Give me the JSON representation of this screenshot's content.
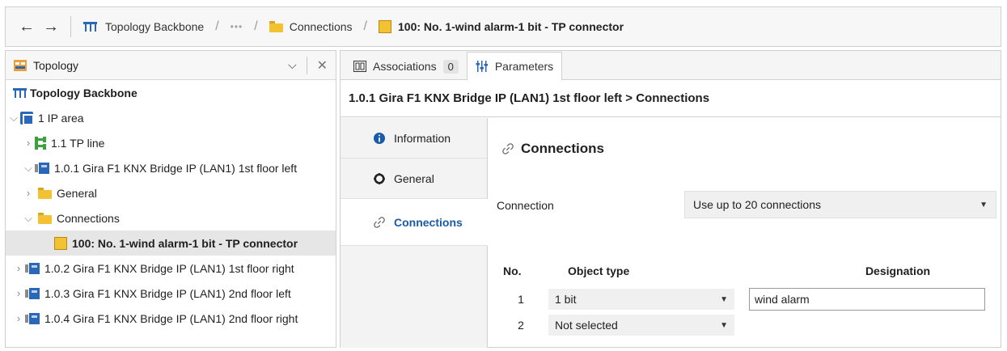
{
  "breadcrumb": {
    "back_label": "←",
    "forward_label": "→",
    "items": [
      {
        "label": "Topology Backbone"
      },
      {
        "label": "•••"
      },
      {
        "label": "Connections"
      },
      {
        "label": "100: No. 1-wind alarm-1 bit - TP connector"
      }
    ],
    "separator": "/"
  },
  "left_panel": {
    "title": "Topology",
    "chevron": "⌵",
    "close": "✕",
    "tree": [
      {
        "label": "Topology Backbone",
        "expander": ""
      },
      {
        "label": "1 IP area",
        "expander": "⌵"
      },
      {
        "label": "1.1 TP line",
        "expander": "›"
      },
      {
        "label": "1.0.1 Gira F1 KNX Bridge IP (LAN1) 1st floor left",
        "expander": "⌵"
      },
      {
        "label": "General",
        "expander": "›"
      },
      {
        "label": "Connections",
        "expander": "⌵"
      },
      {
        "label": "100: No. 1-wind alarm-1 bit - TP connector",
        "expander": ""
      },
      {
        "label": "1.0.2 Gira F1 KNX Bridge IP (LAN1) 1st floor right",
        "expander": "›"
      },
      {
        "label": "1.0.3 Gira F1 KNX Bridge IP (LAN1) 2nd floor left",
        "expander": "›"
      },
      {
        "label": "1.0.4 Gira F1 KNX Bridge IP (LAN1) 2nd floor right",
        "expander": "›"
      }
    ]
  },
  "tabs": [
    {
      "label": "Associations",
      "count": "0"
    },
    {
      "label": "Parameters"
    }
  ],
  "path_title": "1.0.1 Gira F1 KNX Bridge IP (LAN1) 1st floor left > Connections",
  "param_nav": [
    {
      "label": "Information"
    },
    {
      "label": "General"
    },
    {
      "label": "Connections"
    }
  ],
  "section": {
    "title": "Connections",
    "connection_label": "Connection",
    "connection_value": "Use up to 20 connections"
  },
  "table": {
    "headers": {
      "no": "No.",
      "object_type": "Object type",
      "designation": "Designation"
    },
    "rows": [
      {
        "no": "1",
        "object_type": "1 bit",
        "designation": "wind alarm"
      },
      {
        "no": "2",
        "object_type": "Not selected",
        "designation": ""
      }
    ]
  },
  "colors": {
    "accent": "#1a5aa6",
    "folder": "#f2c232",
    "area": "#2a67b8"
  }
}
